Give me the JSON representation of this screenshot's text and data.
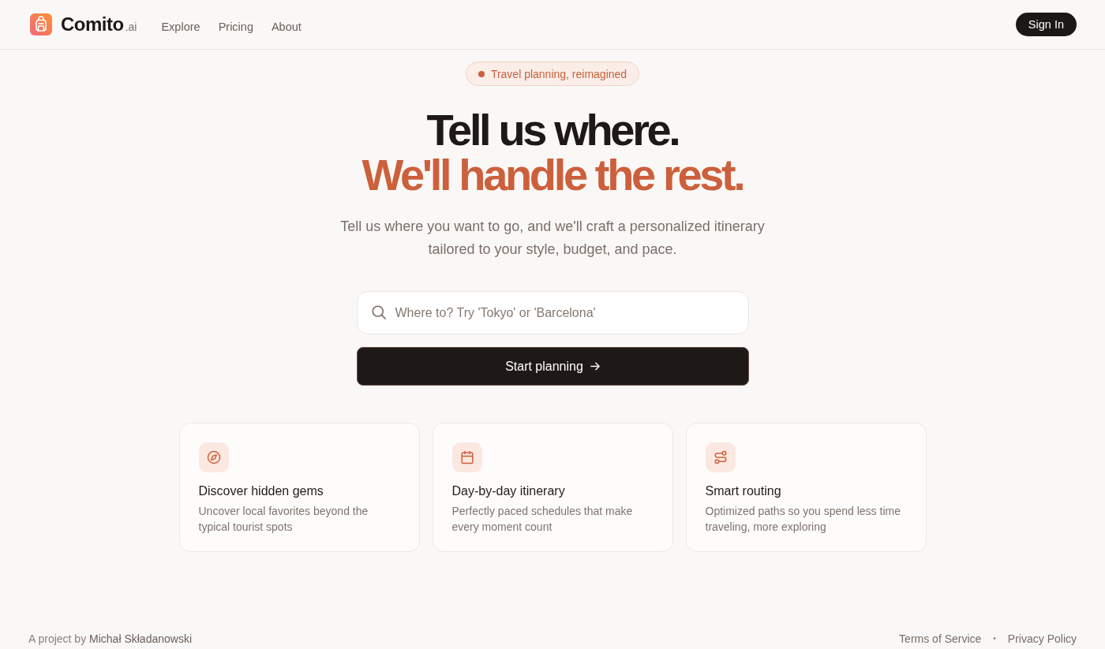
{
  "header": {
    "logo": {
      "name": "Comito",
      "suffix": ".ai"
    },
    "nav": [
      {
        "label": "Explore"
      },
      {
        "label": "Pricing"
      },
      {
        "label": "About"
      }
    ],
    "sign_in": "Sign In"
  },
  "hero": {
    "badge": "Travel planning, reimagined",
    "headline": [
      {
        "kind": "plain",
        "text": "Tell us where."
      },
      {
        "kind": "accent",
        "text": "We'll handle the rest."
      }
    ],
    "subtitle": "Tell us where you want to go, and we'll craft a personalized itinerary tailored to your style, budget, and pace.",
    "search": {
      "placeholder": "Where to? Try 'Tokyo' or 'Barcelona'"
    },
    "start_button": "Start planning"
  },
  "features": [
    {
      "title": "Discover hidden gems",
      "description": "Uncover local favorites beyond the typical tourist spots"
    },
    {
      "title": "Day-by-day itinerary",
      "description": "Perfectly paced schedules that make every moment count"
    },
    {
      "title": "Smart routing",
      "description": "Optimized paths so you spend less time traveling, more exploring"
    }
  ],
  "footer": {
    "credit_prefix": "A project by",
    "author": "Michał Składanowski",
    "links": [
      "Terms of Service",
      "Privacy Policy"
    ],
    "separator": "•"
  }
}
